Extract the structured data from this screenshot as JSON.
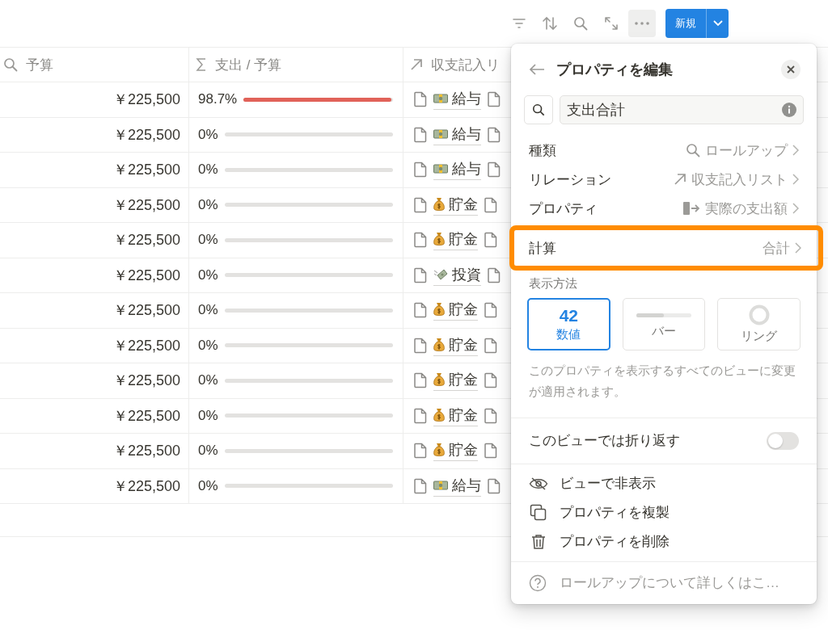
{
  "toolbar": {
    "icons": [
      {
        "kind": "filter"
      },
      {
        "kind": "sort"
      },
      {
        "kind": "search"
      },
      {
        "kind": "expand"
      },
      {
        "kind": "more",
        "selected": true
      }
    ],
    "new_button": "新規"
  },
  "table": {
    "columns": [
      {
        "kind": "search",
        "label": "予算"
      },
      {
        "kind": "sum",
        "label": "支出 / 予算"
      },
      {
        "kind": "relation",
        "label": "収支記入リ"
      }
    ],
    "rows": [
      {
        "budget": "￥225,500",
        "ratio": "98.7%",
        "level": 0.987,
        "relation": {
          "kind": "salary",
          "name": "給与"
        }
      },
      {
        "budget": "￥225,500",
        "ratio": "0%",
        "level": 0,
        "relation": {
          "kind": "salary",
          "name": "給与"
        }
      },
      {
        "budget": "￥225,500",
        "ratio": "0%",
        "level": 0,
        "relation": {
          "kind": "salary",
          "name": "給与"
        }
      },
      {
        "budget": "￥225,500",
        "ratio": "0%",
        "level": 0,
        "relation": {
          "kind": "savings",
          "name": "貯金"
        }
      },
      {
        "budget": "￥225,500",
        "ratio": "0%",
        "level": 0,
        "relation": {
          "kind": "savings",
          "name": "貯金"
        }
      },
      {
        "budget": "￥225,500",
        "ratio": "0%",
        "level": 0,
        "relation": {
          "kind": "investment",
          "name": "投資"
        }
      },
      {
        "budget": "￥225,500",
        "ratio": "0%",
        "level": 0,
        "relation": {
          "kind": "savings",
          "name": "貯金"
        }
      },
      {
        "budget": "￥225,500",
        "ratio": "0%",
        "level": 0,
        "relation": {
          "kind": "savings",
          "name": "貯金"
        }
      },
      {
        "budget": "￥225,500",
        "ratio": "0%",
        "level": 0,
        "relation": {
          "kind": "savings",
          "name": "貯金"
        }
      },
      {
        "budget": "￥225,500",
        "ratio": "0%",
        "level": 0,
        "relation": {
          "kind": "savings",
          "name": "貯金"
        }
      },
      {
        "budget": "￥225,500",
        "ratio": "0%",
        "level": 0,
        "relation": {
          "kind": "savings",
          "name": "貯金"
        }
      },
      {
        "budget": "￥225,500",
        "ratio": "0%",
        "level": 0,
        "relation": {
          "kind": "salary",
          "name": "給与"
        }
      }
    ]
  },
  "popover": {
    "title": "プロパティを編集",
    "name_field": {
      "value": "支出合計"
    },
    "settings": [
      {
        "label": "種類",
        "kind": "search",
        "value": "ロールアップ",
        "highlighted": false
      },
      {
        "label": "リレーション",
        "kind": "relation",
        "value": "収支記入リスト",
        "highlighted": false
      },
      {
        "label": "プロパティ",
        "kind": "property",
        "value": "実際の支出額",
        "highlighted": false
      },
      {
        "label": "計算",
        "kind": "none",
        "value": "合計",
        "highlighted": true
      }
    ],
    "display_label": "表示方法",
    "display_options": [
      {
        "kind": "number",
        "preview": "42",
        "label": "数値",
        "selected": true
      },
      {
        "kind": "bar",
        "label": "バー",
        "selected": false
      },
      {
        "kind": "ring",
        "label": "リング",
        "selected": false
      }
    ],
    "note": "このプロパティを表示するすべてのビューに変更が適用されます。",
    "wrap_toggle": {
      "label": "このビューでは折り返す",
      "on": false
    },
    "actions": [
      {
        "kind": "hide",
        "label": "ビューで非表示"
      },
      {
        "kind": "duplicate",
        "label": "プロパティを複製"
      },
      {
        "kind": "delete",
        "label": "プロパティを削除"
      }
    ],
    "help": "ロールアップについて詳しくはこ…"
  }
}
